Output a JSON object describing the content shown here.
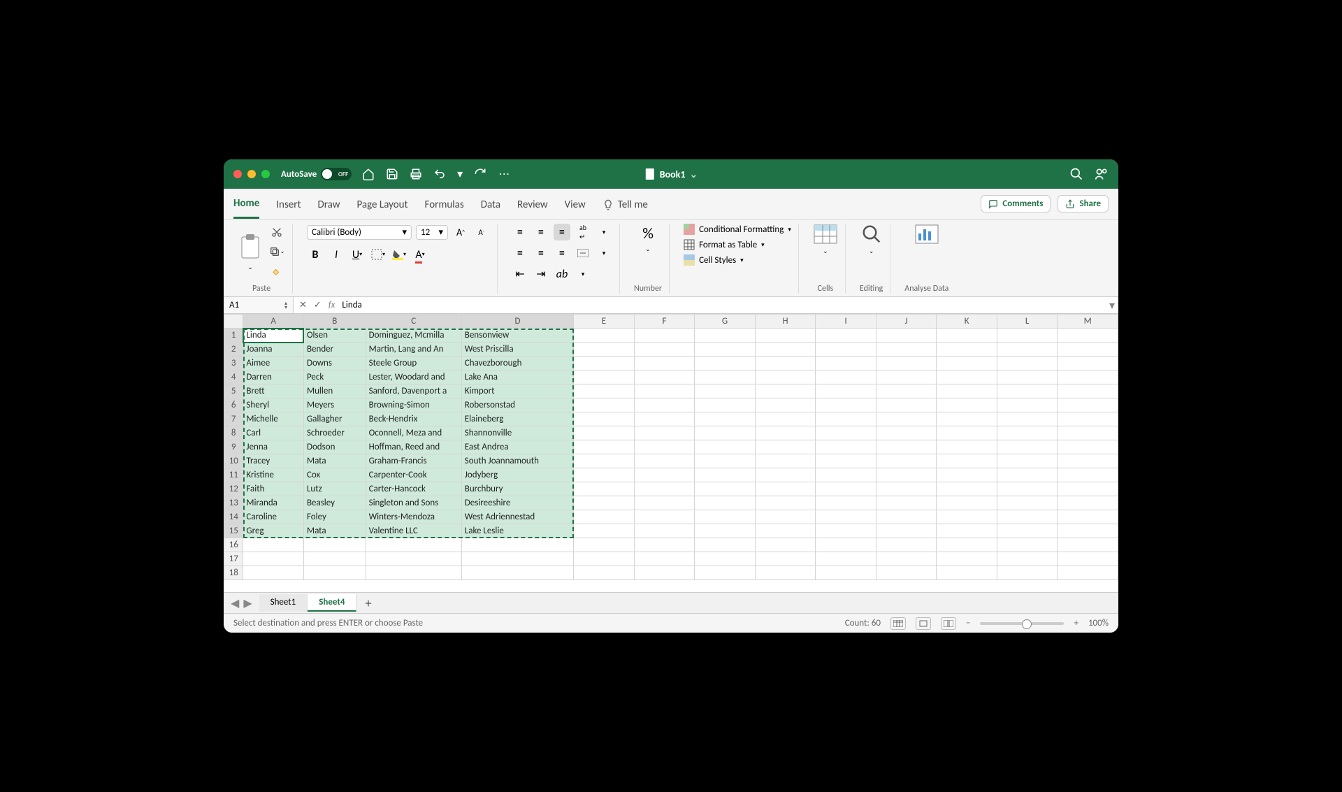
{
  "titlebar": {
    "autosave_label": "AutoSave",
    "autosave_state": "OFF",
    "doc_title": "Book1"
  },
  "tabs": {
    "items": [
      "Home",
      "Insert",
      "Draw",
      "Page Layout",
      "Formulas",
      "Data",
      "Review",
      "View"
    ],
    "tell_me": "Tell me",
    "comments": "Comments",
    "share": "Share",
    "active": "Home"
  },
  "ribbon": {
    "paste": "Paste",
    "font_name": "Calibri (Body)",
    "font_size": "12",
    "number": "Number",
    "cond_fmt": "Conditional Formatting",
    "fmt_table": "Format as Table",
    "cell_styles": "Cell Styles",
    "cells": "Cells",
    "editing": "Editing",
    "analyse": "Analyse Data"
  },
  "formula": {
    "namebox": "A1",
    "value": "Linda"
  },
  "columns": [
    "A",
    "B",
    "C",
    "D",
    "E",
    "F",
    "G",
    "H",
    "I",
    "J",
    "K",
    "L",
    "M"
  ],
  "rows": [
    [
      "Linda",
      "Olsen",
      "Dominguez, Mcmilla",
      "Bensonview"
    ],
    [
      "Joanna",
      "Bender",
      "Martin, Lang and An",
      "West Priscilla"
    ],
    [
      "Aimee",
      "Downs",
      "Steele Group",
      "Chavezborough"
    ],
    [
      "Darren",
      "Peck",
      "Lester, Woodard and",
      "Lake Ana"
    ],
    [
      "Brett",
      "Mullen",
      "Sanford, Davenport a",
      "Kimport"
    ],
    [
      "Sheryl",
      "Meyers",
      "Browning-Simon",
      "Robersonstad"
    ],
    [
      "Michelle",
      "Gallagher",
      "Beck-Hendrix",
      "Elaineberg"
    ],
    [
      "Carl",
      "Schroeder",
      "Oconnell, Meza and",
      "Shannonville"
    ],
    [
      "Jenna",
      "Dodson",
      "Hoffman, Reed and",
      "East Andrea"
    ],
    [
      "Tracey",
      "Mata",
      "Graham-Francis",
      "South Joannamouth"
    ],
    [
      "Kristine",
      "Cox",
      "Carpenter-Cook",
      "Jodyberg"
    ],
    [
      "Faith",
      "Lutz",
      "Carter-Hancock",
      "Burchbury"
    ],
    [
      "Miranda",
      "Beasley",
      "Singleton and Sons",
      "Desireeshire"
    ],
    [
      "Caroline",
      "Foley",
      "Winters-Mendoza",
      "West Adriennestad"
    ],
    [
      "Greg",
      "Mata",
      "Valentine LLC",
      "Lake Leslie"
    ]
  ],
  "total_visible_rows": 18,
  "selection": {
    "r1": 1,
    "c1": 1,
    "r2": 15,
    "c2": 4,
    "active": "A1"
  },
  "sheets": {
    "items": [
      "Sheet1",
      "Sheet4"
    ],
    "active": "Sheet4"
  },
  "status": {
    "message": "Select destination and press ENTER or choose Paste",
    "count": "Count: 60",
    "zoom": "100%"
  }
}
